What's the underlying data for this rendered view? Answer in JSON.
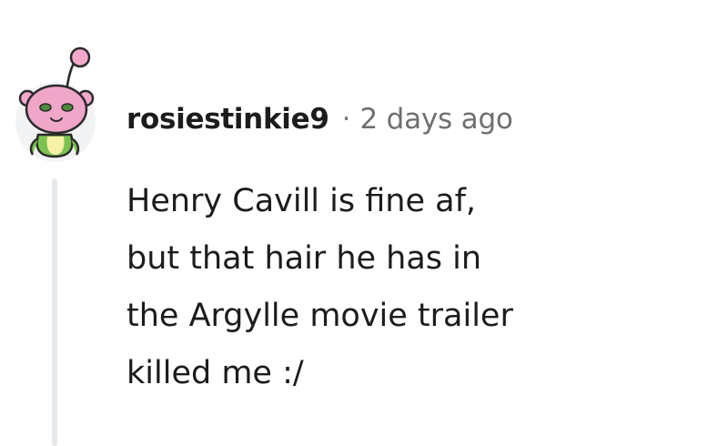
{
  "comment": {
    "author": "rosiestinkie9",
    "separator": "·",
    "timestamp": "2 days ago",
    "body_lines": [
      "Henry Cavill is fine af,",
      "but that hair he has in",
      "the Argylle movie trailer",
      "killed me :/"
    ],
    "avatar_icon": "snoo-avatar-icon"
  },
  "colors": {
    "avatar_head": "#f0a6c9",
    "avatar_body": "#7cc251",
    "avatar_belly": "#f6f0a8",
    "thread_line": "#e6e9eb",
    "text": "#1c1c1c",
    "meta_text": "#6f6f6f"
  }
}
